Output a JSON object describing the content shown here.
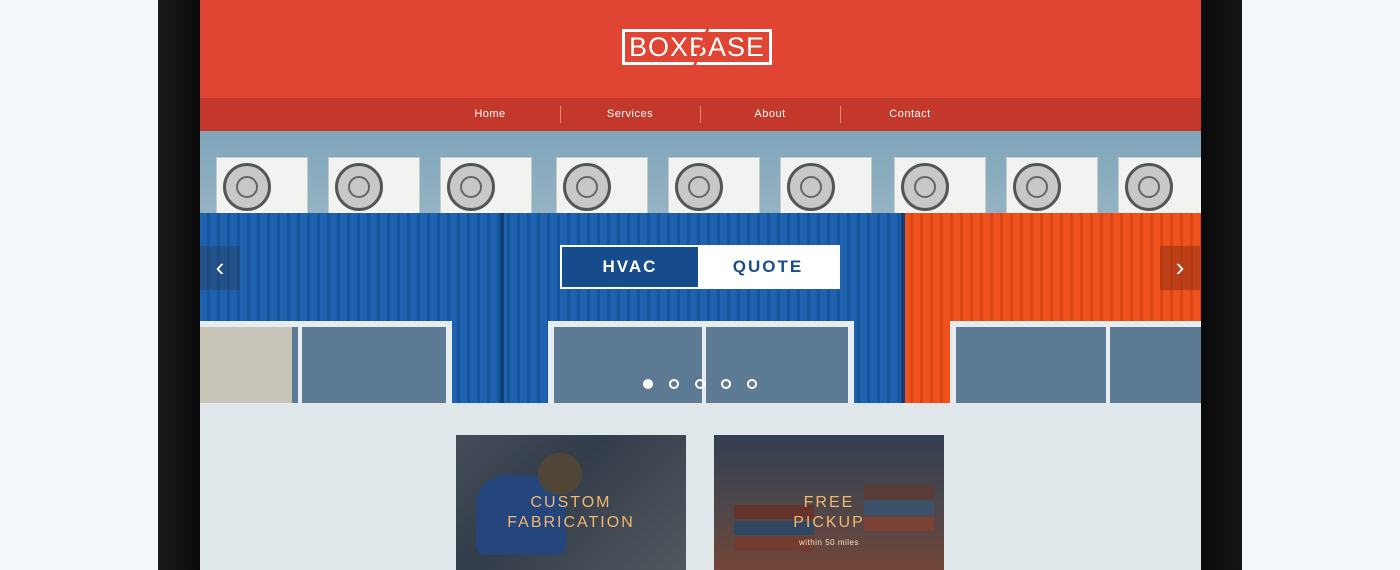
{
  "site": {
    "logo_text": "BOXBASE"
  },
  "nav": {
    "items": [
      {
        "label": "Home"
      },
      {
        "label": "Services"
      },
      {
        "label": "About"
      },
      {
        "label": "Contact"
      }
    ]
  },
  "hero": {
    "badge_left": "HVAC",
    "badge_right": "QUOTE",
    "prev_icon": "‹",
    "next_icon": "›",
    "slide_count": 5,
    "active_slide": 1
  },
  "cards": [
    {
      "title_line1": "CUSTOM",
      "title_line2": "FABRICATION",
      "subtitle": ""
    },
    {
      "title_line1": "FREE",
      "title_line2": "PICKUP",
      "subtitle": "within 50 miles"
    }
  ],
  "colors": {
    "header_red": "#e04432",
    "nav_red": "#c3382a",
    "badge_blue": "#174c8c",
    "card_text": "#f4b76f"
  }
}
